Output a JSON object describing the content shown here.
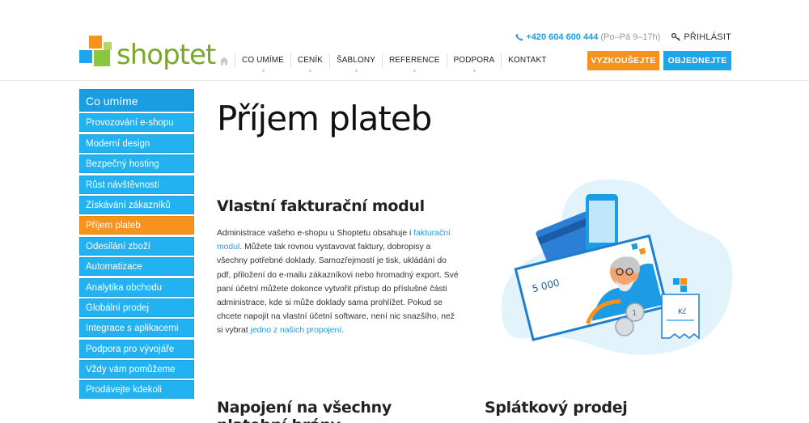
{
  "brand": {
    "name": "shoptet",
    "green": "#7aa82b",
    "orange": "#f6921e",
    "blue": "#1da6ea"
  },
  "topbar": {
    "phone": "+420 604 600 444",
    "hours": "(Po–Pá 9–17h)",
    "login": "PŘIHLÁSIT"
  },
  "nav": {
    "home_icon": "home-icon",
    "items": [
      "CO UMÍME",
      "CENÍK",
      "ŠABLONY",
      "REFERENCE",
      "PODPORA",
      "KONTAKT"
    ]
  },
  "buttons": {
    "try": "VYZKOUŠEJTE",
    "order": "OBJEDNEJTE"
  },
  "sidebar": {
    "heading": "Co umíme",
    "items": [
      "Provozování e-shopu",
      "Moderní design",
      "Bezpečný hosting",
      "Růst návštěvnosti",
      "Získávání zákazníků",
      "Příjem plateb",
      "Odesílání zboží",
      "Automatizace",
      "Analytika obchodu",
      "Globální prodej",
      "Integrace s aplikacemi",
      "Podpora pro vývojáře",
      "Vždy vám pomůžeme",
      "Prodávejte kdekoli"
    ],
    "active": "Příjem plateb"
  },
  "main": {
    "title": "Příjem plateb",
    "section1": {
      "heading": "Vlastní fakturační modul",
      "text_1": "Administrace vašeho e-shopu u Shoptetu obsahuje i ",
      "link_1": "fakturační modul",
      "text_2": ". Můžete tak rovnou vystavovat faktury, dobropisy a všechny potřebné doklady. Samozřejmostí je tisk, ukládání do pdf, přiložení do e-mailu zákazníkovi nebo hromadný export. Své paní účetní můžete dokonce vytvořit přístup do příslušné části administrace, kde si může doklady sama prohlížet. Pokud se chcete napojit na vlastní účetní software, není nic snazšího, než si vybrat ",
      "link_2": "jedno z našich propojení",
      "text_3": "."
    },
    "section2_heading": "Napojení na všechny platební brány",
    "section3_heading": "Splátkový prodej"
  },
  "illustration": {
    "banknote_value": "5 000",
    "receipt_currency": "Kč",
    "coin_value": "1"
  }
}
